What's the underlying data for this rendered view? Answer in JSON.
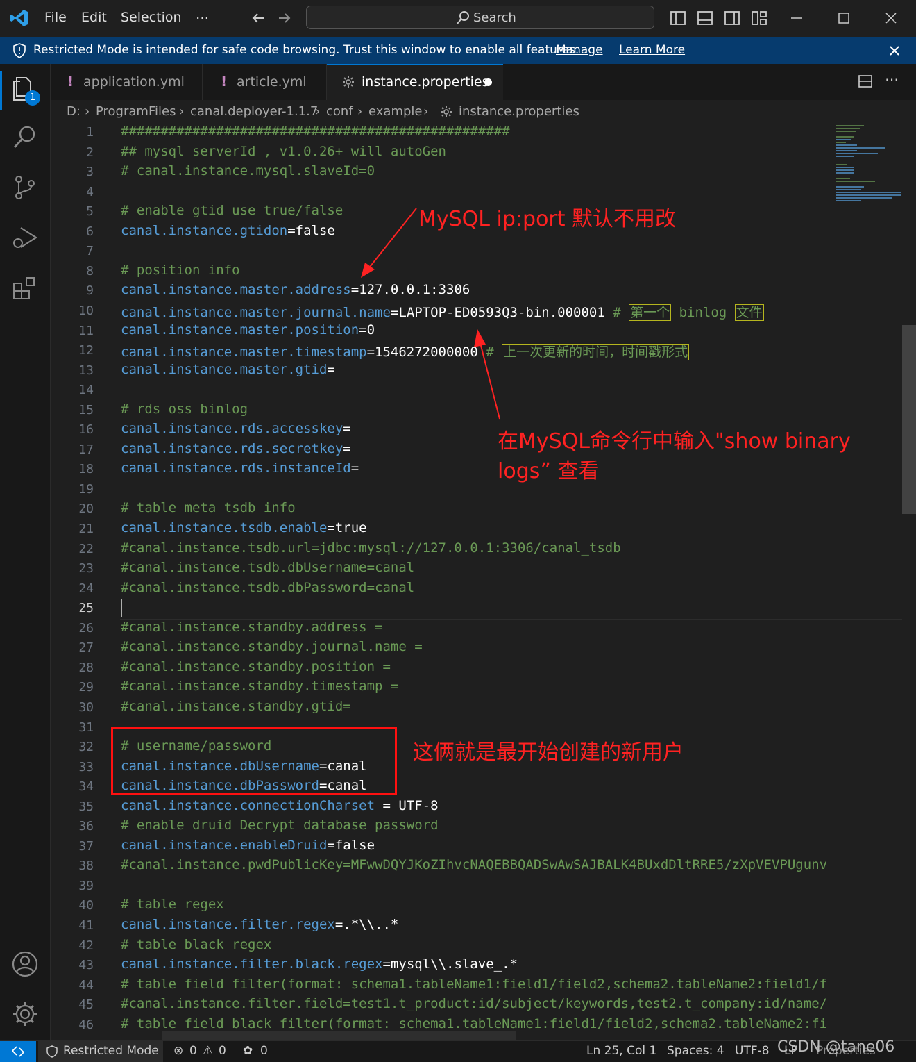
{
  "titlebar": {
    "menu": [
      "File",
      "Edit",
      "Selection",
      "…"
    ],
    "search_label": "Search"
  },
  "banner": {
    "message": "Restricted Mode is intended for safe code browsing. Trust this window to enable all features.",
    "manage": "Manage",
    "learn_more": "Learn More"
  },
  "activity": {
    "explorer_badge": "1"
  },
  "tabs": [
    {
      "label": "application.yml",
      "icon": "exclamation-icon",
      "active": false
    },
    {
      "label": "article.yml",
      "icon": "exclamation-icon",
      "active": false
    },
    {
      "label": "instance.properties",
      "icon": "gear-icon",
      "active": true,
      "dirty": true
    }
  ],
  "breadcrumb": [
    "D:",
    "ProgramFiles",
    "canal.deployer-1.1.7",
    "conf",
    "example",
    "instance.properties"
  ],
  "lines": [
    {
      "n": "1",
      "t": "#################################################"
    },
    {
      "n": "2",
      "t": "## mysql serverId , v1.0.26+ will autoGen"
    },
    {
      "n": "3",
      "t": "# canal.instance.mysql.slaveId=0"
    },
    {
      "n": "4",
      "t": ""
    },
    {
      "n": "5",
      "t": "# enable gtid use true/false"
    },
    {
      "n": "6",
      "k": "canal.instance.gtidon",
      "v": "=false"
    },
    {
      "n": "7",
      "t": ""
    },
    {
      "n": "8",
      "t": "# position info"
    },
    {
      "n": "9",
      "k": "canal.instance.master.address",
      "v": "=127.0.0.1:3306"
    },
    {
      "n": "10",
      "k": "canal.instance.master.journal.name",
      "v": "=LAPTOP-ED0593Q3-bin.000001 ",
      "c1": "# ",
      "b1": "第一个",
      "c2": " binlog ",
      "b2": "文件"
    },
    {
      "n": "11",
      "k": "canal.instance.master.position",
      "v": "=0"
    },
    {
      "n": "12",
      "k": "canal.instance.master.timestamp",
      "v": "=1546272000000 ",
      "c1": "# ",
      "b1": "上一次更新的时间，时间戳形式"
    },
    {
      "n": "13",
      "k": "canal.instance.master.gtid",
      "v": "="
    },
    {
      "n": "14",
      "t": ""
    },
    {
      "n": "15",
      "t": "# rds oss binlog"
    },
    {
      "n": "16",
      "k": "canal.instance.rds.accesskey",
      "v": "="
    },
    {
      "n": "17",
      "k": "canal.instance.rds.secretkey",
      "v": "="
    },
    {
      "n": "18",
      "k": "canal.instance.rds.instanceId",
      "v": "="
    },
    {
      "n": "19",
      "t": ""
    },
    {
      "n": "20",
      "t": "# table meta tsdb info"
    },
    {
      "n": "21",
      "k": "canal.instance.tsdb.enable",
      "v": "=true"
    },
    {
      "n": "22",
      "t": "#canal.instance.tsdb.url=jdbc:mysql://127.0.0.1:3306/canal_tsdb"
    },
    {
      "n": "23",
      "t": "#canal.instance.tsdb.dbUsername=canal"
    },
    {
      "n": "24",
      "t": "#canal.instance.tsdb.dbPassword=canal"
    },
    {
      "n": "25",
      "t": ""
    },
    {
      "n": "26",
      "t": "#canal.instance.standby.address ="
    },
    {
      "n": "27",
      "t": "#canal.instance.standby.journal.name ="
    },
    {
      "n": "28",
      "t": "#canal.instance.standby.position ="
    },
    {
      "n": "29",
      "t": "#canal.instance.standby.timestamp ="
    },
    {
      "n": "30",
      "t": "#canal.instance.standby.gtid="
    },
    {
      "n": "31",
      "t": ""
    },
    {
      "n": "32",
      "t": "# username/password"
    },
    {
      "n": "33",
      "k": "canal.instance.dbUsername",
      "v": "=canal"
    },
    {
      "n": "34",
      "k": "canal.instance.dbPassword",
      "v": "=canal"
    },
    {
      "n": "35",
      "k": "canal.instance.connectionCharset",
      "v": " = UTF-8"
    },
    {
      "n": "36",
      "t": "# enable druid Decrypt database password"
    },
    {
      "n": "37",
      "k": "canal.instance.enableDruid",
      "v": "=false"
    },
    {
      "n": "38",
      "t": "#canal.instance.pwdPublicKey=MFwwDQYJKoZIhvcNAQEBBQADSwAwSAJBALK4BUxdDltRRE5/zXpVEVPUgunv"
    },
    {
      "n": "39",
      "t": ""
    },
    {
      "n": "40",
      "t": "# table regex"
    },
    {
      "n": "41",
      "k": "canal.instance.filter.regex",
      "v": "=.*\\\\..*"
    },
    {
      "n": "42",
      "t": "# table black regex"
    },
    {
      "n": "43",
      "k": "canal.instance.filter.black.regex",
      "v": "=mysql\\\\.slave_.*"
    },
    {
      "n": "44",
      "t": "# table field filter(format: schema1.tableName1:field1/field2,schema2.tableName2:field1/f"
    },
    {
      "n": "45",
      "t": "#canal.instance.filter.field=test1.t_product:id/subject/keywords,test2.t_company:id/name/"
    },
    {
      "n": "46",
      "t": "# table field black filter(format: schema1.tableName1:field1/field2,schema2.tableName2:fi"
    }
  ],
  "annotations": {
    "a1": "MySQL ip:port 默认不用改",
    "a2_line1": "在MySQL命令行中输入\"show binary",
    "a2_line2": "logs” 查看",
    "a3": "这俩就是最开始创建的新用户"
  },
  "status": {
    "restricted": "Restricted Mode",
    "errors": "0",
    "warnings": "0",
    "ports": "0",
    "position": "Ln 25, Col 1",
    "spaces": "Spaces: 4",
    "encoding": "UTF-8",
    "eol": "LF",
    "language": "Properties",
    "watermark": "CSDN @tane06"
  },
  "colors": {
    "accent": "#0078d4",
    "banner": "#063b6e",
    "comment": "#6a9955",
    "key": "#569cd6",
    "annotation": "#ff2222"
  }
}
